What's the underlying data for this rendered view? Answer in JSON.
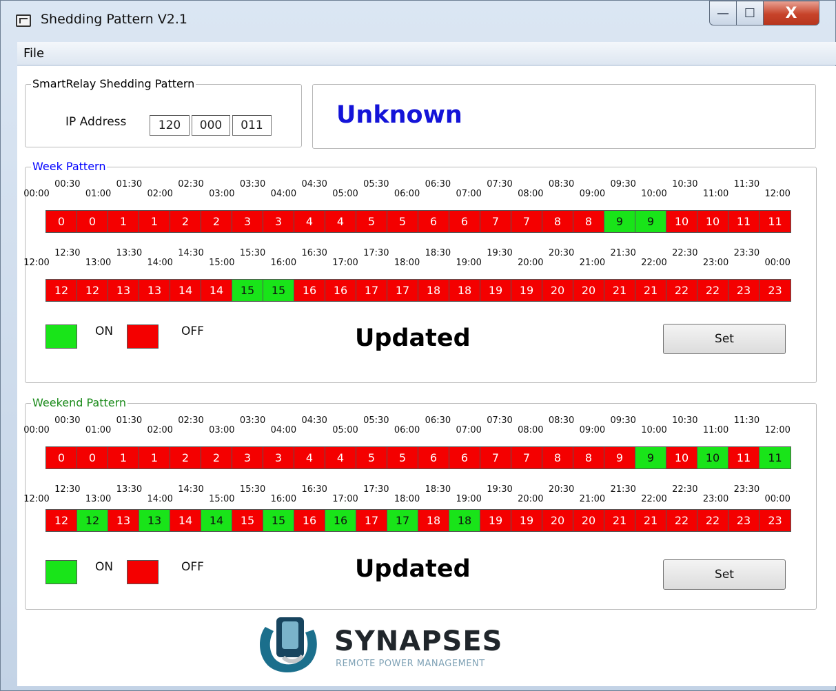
{
  "window": {
    "title": "Shedding Pattern V2.1",
    "controls": {
      "minimize": "—",
      "maximize": "☐",
      "close": "X"
    }
  },
  "menu": {
    "file_label": "File"
  },
  "smartrelay": {
    "legend": "SmartRelay Shedding Pattern",
    "ip_label": "IP Address",
    "ip": [
      "120",
      "000",
      "011"
    ]
  },
  "status": {
    "text": "Unknown",
    "color": "#1414d8"
  },
  "colors": {
    "on": "#19e419",
    "off": "#f40000"
  },
  "time_labels_row1": {
    "top": [
      "00:30",
      "01:30",
      "02:30",
      "03:30",
      "04:30",
      "05:30",
      "06:30",
      "07:30",
      "08:30",
      "09:30",
      "10:30",
      "11:30"
    ],
    "bottom": [
      "00:00",
      "01:00",
      "02:00",
      "03:00",
      "04:00",
      "05:00",
      "06:00",
      "07:00",
      "08:00",
      "09:00",
      "10:00",
      "11:00",
      "12:00"
    ]
  },
  "time_labels_row2": {
    "top": [
      "12:30",
      "13:30",
      "14:30",
      "15:30",
      "16:30",
      "17:30",
      "18:30",
      "19:30",
      "20:30",
      "21:30",
      "22:30",
      "23:30"
    ],
    "bottom": [
      "12:00",
      "13:00",
      "14:00",
      "15:00",
      "16:00",
      "17:00",
      "18:00",
      "19:00",
      "20:00",
      "21:00",
      "22:00",
      "23:00",
      "00:00"
    ]
  },
  "week": {
    "legend": "Week Pattern",
    "legend_color": "#0000ff",
    "row1": {
      "labels": [
        "0",
        "0",
        "1",
        "1",
        "2",
        "2",
        "3",
        "3",
        "4",
        "4",
        "5",
        "5",
        "6",
        "6",
        "7",
        "7",
        "8",
        "8",
        "9",
        "9",
        "10",
        "10",
        "11",
        "11"
      ],
      "states": [
        "off",
        "off",
        "off",
        "off",
        "off",
        "off",
        "off",
        "off",
        "off",
        "off",
        "off",
        "off",
        "off",
        "off",
        "off",
        "off",
        "off",
        "off",
        "on",
        "on",
        "off",
        "off",
        "off",
        "off"
      ]
    },
    "row2": {
      "labels": [
        "12",
        "12",
        "13",
        "13",
        "14",
        "14",
        "15",
        "15",
        "16",
        "16",
        "17",
        "17",
        "18",
        "18",
        "19",
        "19",
        "20",
        "20",
        "21",
        "21",
        "22",
        "22",
        "23",
        "23"
      ],
      "states": [
        "off",
        "off",
        "off",
        "off",
        "off",
        "off",
        "on",
        "on",
        "off",
        "off",
        "off",
        "off",
        "off",
        "off",
        "off",
        "off",
        "off",
        "off",
        "off",
        "off",
        "off",
        "off",
        "off",
        "off"
      ]
    },
    "on_label": "ON",
    "off_label": "OFF",
    "status": "Updated",
    "set_label": "Set"
  },
  "weekend": {
    "legend": "Weekend Pattern",
    "legend_color": "#1a8a1a",
    "row1": {
      "labels": [
        "0",
        "0",
        "1",
        "1",
        "2",
        "2",
        "3",
        "3",
        "4",
        "4",
        "5",
        "5",
        "6",
        "6",
        "7",
        "7",
        "8",
        "8",
        "9",
        "9",
        "10",
        "10",
        "11",
        "11"
      ],
      "states": [
        "off",
        "off",
        "off",
        "off",
        "off",
        "off",
        "off",
        "off",
        "off",
        "off",
        "off",
        "off",
        "off",
        "off",
        "off",
        "off",
        "off",
        "off",
        "off",
        "on",
        "off",
        "on",
        "off",
        "on"
      ]
    },
    "row2": {
      "labels": [
        "12",
        "12",
        "13",
        "13",
        "14",
        "14",
        "15",
        "15",
        "16",
        "16",
        "17",
        "17",
        "18",
        "18",
        "19",
        "19",
        "20",
        "20",
        "21",
        "21",
        "22",
        "22",
        "23",
        "23"
      ],
      "states": [
        "off",
        "on",
        "off",
        "on",
        "off",
        "on",
        "off",
        "on",
        "off",
        "on",
        "off",
        "on",
        "off",
        "on",
        "off",
        "off",
        "off",
        "off",
        "off",
        "off",
        "off",
        "off",
        "off",
        "off"
      ]
    },
    "on_label": "ON",
    "off_label": "OFF",
    "status": "Updated",
    "set_label": "Set"
  },
  "logo": {
    "word": "SYNAPSES",
    "tagline": "REMOTE POWER MANAGEMENT"
  }
}
